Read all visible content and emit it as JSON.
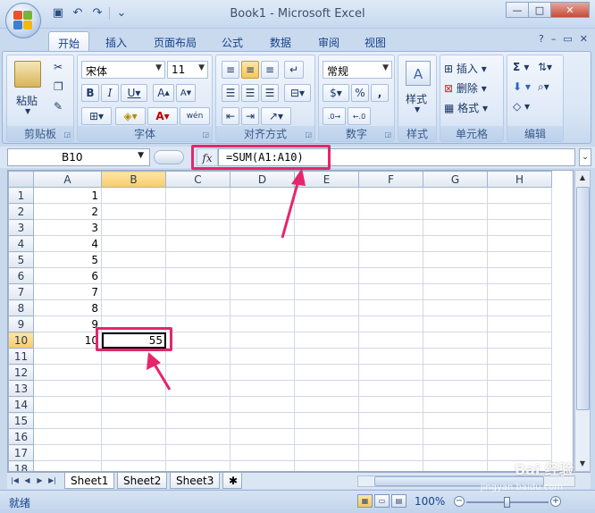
{
  "window": {
    "title": "Book1 - Microsoft Excel",
    "controls": {
      "minimize": "—",
      "maximize": "□",
      "close": "✕"
    }
  },
  "qat": {
    "icons": [
      "save-icon",
      "undo-icon",
      "redo-icon",
      "customize-icon"
    ]
  },
  "ribbon": {
    "tabs": [
      "开始",
      "插入",
      "页面布局",
      "公式",
      "数据",
      "审阅",
      "视图"
    ],
    "active_tab": "开始",
    "groups": {
      "clipboard": {
        "label": "剪贴板",
        "paste": "粘贴"
      },
      "font": {
        "label": "字体",
        "font_name": "宋体",
        "font_size": "11",
        "wen": "wén"
      },
      "alignment": {
        "label": "对齐方式"
      },
      "number": {
        "label": "数字",
        "format": "常规"
      },
      "styles": {
        "label": "样式",
        "button": "样式"
      },
      "cells": {
        "label": "单元格",
        "insert": "插入",
        "delete": "删除",
        "format": "格式"
      },
      "editing": {
        "label": "编辑"
      }
    }
  },
  "formula_bar": {
    "name_box": "B10",
    "fx": "fx",
    "formula": "=SUM(A1:A10)"
  },
  "grid": {
    "columns": [
      "A",
      "B",
      "C",
      "D",
      "E",
      "F",
      "G",
      "H"
    ],
    "rows": [
      "1",
      "2",
      "3",
      "4",
      "5",
      "6",
      "7",
      "8",
      "9",
      "10",
      "11",
      "12",
      "13",
      "14",
      "15",
      "16",
      "17",
      "18"
    ],
    "column_a": [
      "1",
      "2",
      "3",
      "4",
      "5",
      "6",
      "7",
      "8",
      "9",
      "10",
      "",
      "",
      "",
      "",
      "",
      "",
      "",
      ""
    ],
    "active_cell": "B10",
    "active_value": "55"
  },
  "sheets": {
    "tabs": [
      "Sheet1",
      "Sheet2",
      "Sheet3"
    ],
    "active": "Sheet1"
  },
  "status": {
    "ready": "就绪",
    "zoom": "100%"
  },
  "watermark": {
    "text": "Bai 经验",
    "url": "jingyan.baidu.com"
  },
  "colors": {
    "highlight": "#e6256c",
    "selected_header": "#f8cb6a"
  }
}
